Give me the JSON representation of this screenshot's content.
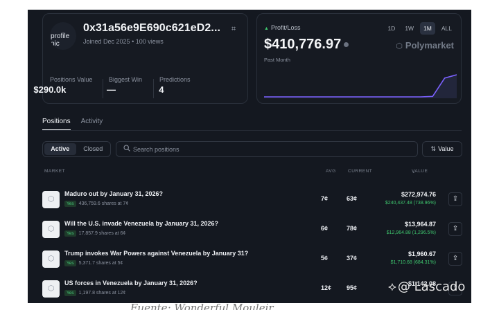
{
  "profile": {
    "avatar_alt": "profile pic",
    "address": "0x31a56e9E690c621eD2...",
    "joined": "Joined Dec 2025",
    "views": "100 views",
    "stats": [
      {
        "label": "Positions Value",
        "value": "$290.0k"
      },
      {
        "label": "Biggest Win",
        "value": "—"
      },
      {
        "label": "Predictions",
        "value": "4"
      }
    ]
  },
  "pnl": {
    "label": "Profit/Loss",
    "value": "$410,776.97",
    "period": "Past Month",
    "ranges": [
      "1D",
      "1W",
      "1M",
      "ALL"
    ],
    "active_range": "1M",
    "brand": "Polymarket",
    "trend": [
      0,
      0,
      0,
      0,
      0,
      0,
      0,
      0,
      0,
      0,
      0,
      0,
      0,
      0,
      0.02,
      0.85,
      1
    ],
    "line_color": "#7b61ff"
  },
  "tabs": [
    "Positions",
    "Activity"
  ],
  "filters": {
    "segments": [
      "Active",
      "Closed"
    ],
    "search_placeholder": "Search positions",
    "sort_label": "Value"
  },
  "table": {
    "headers": {
      "market": "MARKET",
      "avg": "AVG",
      "current": "CURRENT",
      "value": "VALUE"
    },
    "rows": [
      {
        "title": "Maduro out by January 31, 2026?",
        "outcome": "Yes",
        "shares": "436,759.6 shares at 7¢",
        "avg": "7¢",
        "current": "63¢",
        "value": "$272,974.76",
        "pnl": "$240,437.48 (738.96%)"
      },
      {
        "title": "Will the U.S. invade Venezuela by January 31, 2026?",
        "outcome": "Yes",
        "shares": "17,857.9 shares at 6¢",
        "avg": "6¢",
        "current": "78¢",
        "value": "$13,964.87",
        "pnl": "$12,964.88 (1,296.5%)"
      },
      {
        "title": "Trump invokes War Powers against Venezuela by January 31?",
        "outcome": "Yes",
        "shares": "5,371.7 shares at 5¢",
        "avg": "5¢",
        "current": "37¢",
        "value": "$1,960.67",
        "pnl": "$1,710.68 (684.31%)"
      },
      {
        "title": "US forces in Venezuela by January 31, 2026?",
        "outcome": "Yes",
        "shares": "1,197.8 shares at 12¢",
        "avg": "12¢",
        "current": "95¢",
        "value": "$1,142.08",
        "pnl": ""
      }
    ]
  },
  "watermark": "@ Lascado",
  "caption": "Fuente: Wonderful Mouleir"
}
